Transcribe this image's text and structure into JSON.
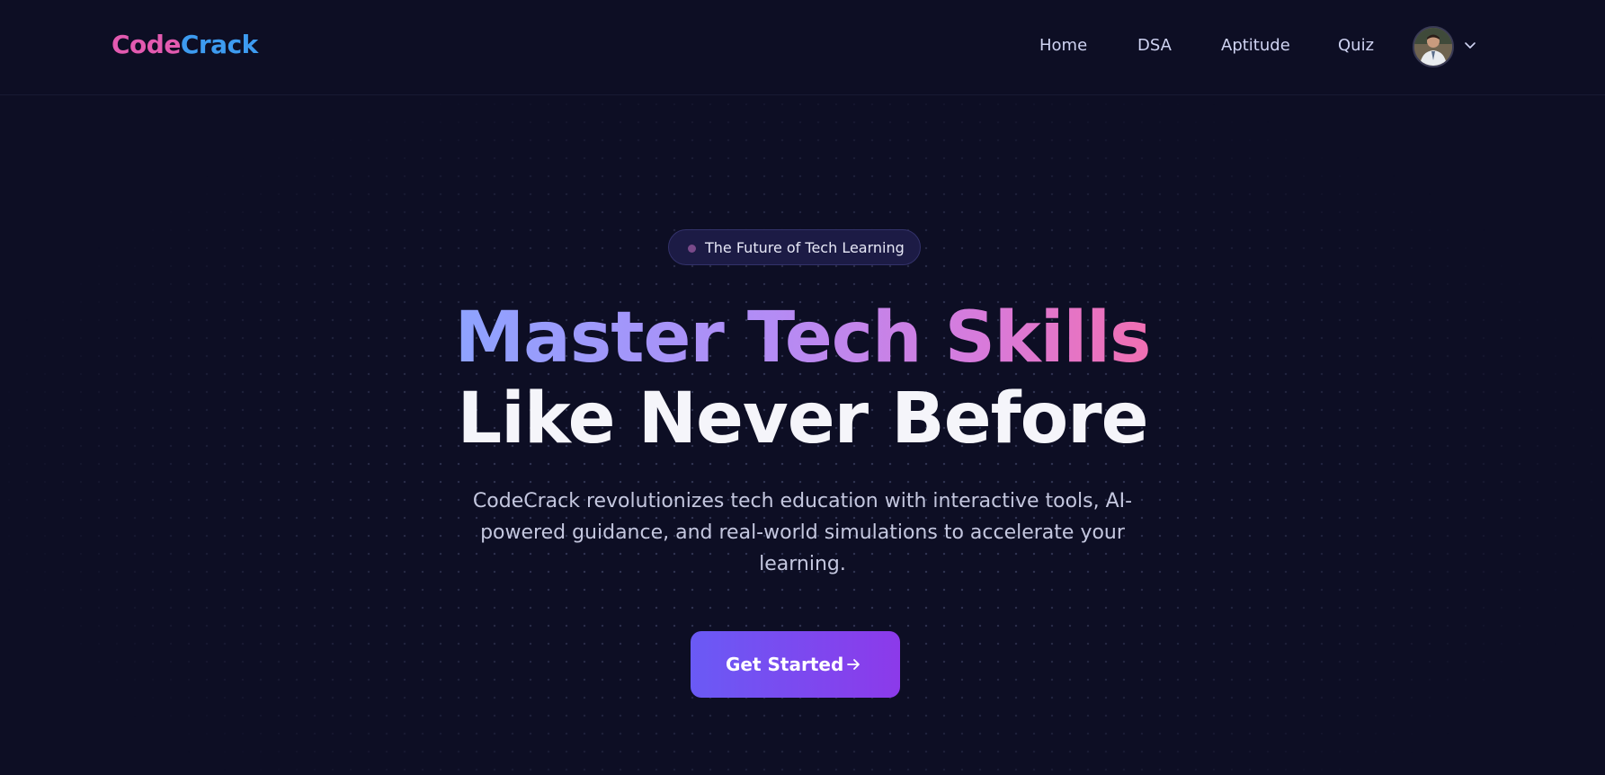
{
  "header": {
    "logo_part1": "Code",
    "logo_part2": "Crack",
    "nav": [
      {
        "label": "Home"
      },
      {
        "label": "DSA"
      },
      {
        "label": "Aptitude"
      },
      {
        "label": "Quiz"
      }
    ],
    "avatar_icon": "user-avatar-photo",
    "menu_icon": "chevron-down-icon"
  },
  "hero": {
    "badge": "The Future of Tech Learning",
    "headline_line1": "Master Tech Skills",
    "headline_line2": "Like Never Before",
    "subtitle": "CodeCrack revolutionizes tech education with interactive tools, AI-powered guidance, and real-world simulations to accelerate your learning.",
    "cta_label": "Get Started",
    "cta_icon": "arrow-right-icon"
  },
  "colors": {
    "background": "#0d0e24",
    "logo_code": "#e35ab0",
    "logo_crack": "#3d9bf0",
    "headline_gradient_start": "#8ea3ff",
    "headline_gradient_end": "#f06fb2",
    "cta_gradient_start": "#6a5af5",
    "cta_gradient_end": "#8c3aea"
  }
}
